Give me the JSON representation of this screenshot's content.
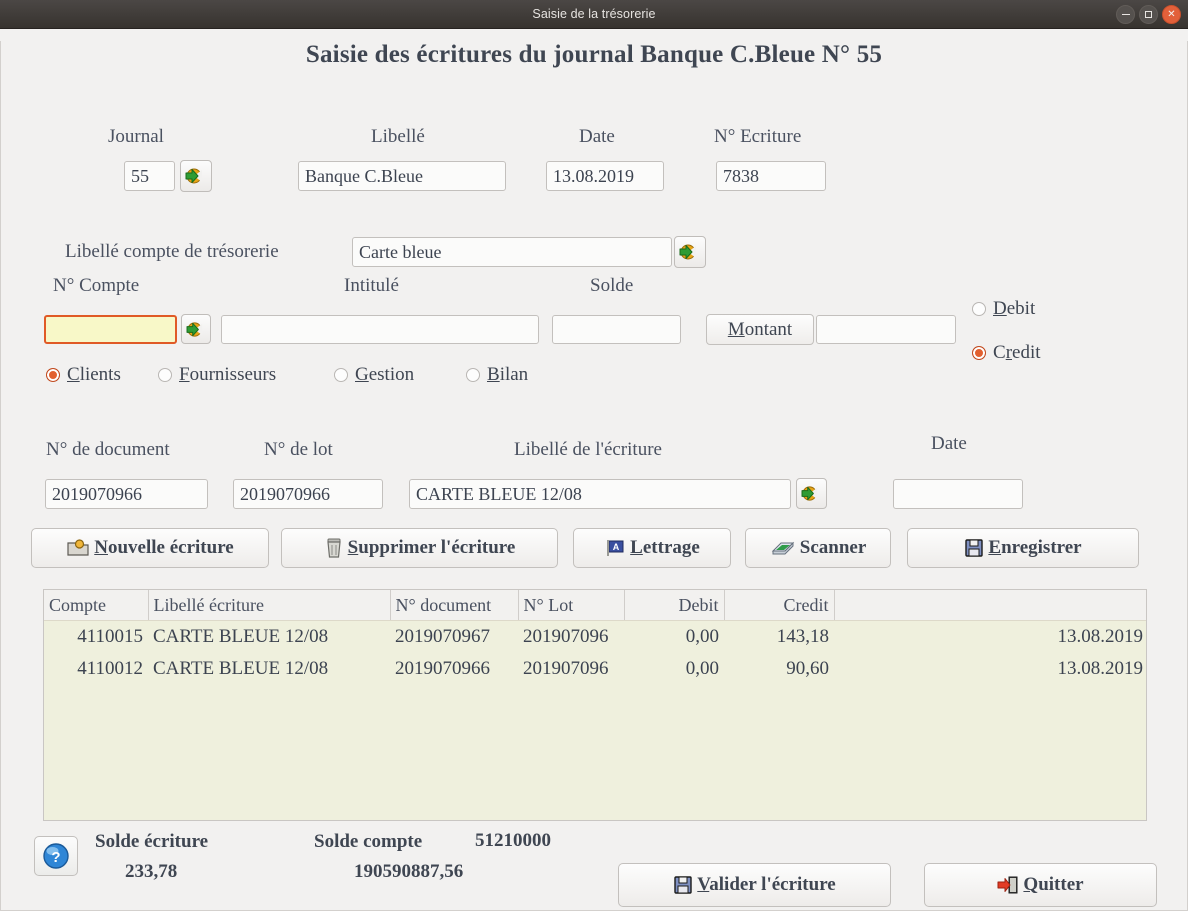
{
  "window": {
    "title": "Saisie de la trésorerie",
    "controls": {
      "minimize": "–",
      "maximize": "□",
      "close": "×"
    }
  },
  "page_title": "Saisie des écritures du journal Banque C.Bleue N° 55",
  "colors": {
    "accent": "#e2602f",
    "grid_background": "#eff0dd",
    "focus_field_background": "#f8f8c8",
    "titlebar": "#3f3b38"
  },
  "header_form": {
    "journal_label": "Journal",
    "journal_value": "55",
    "libelle_label": "Libellé",
    "libelle_value": "Banque C.Bleue",
    "date_label": "Date",
    "date_value": "13.08.2019",
    "ecriture_label": "N° Ecriture",
    "ecriture_value": "7838"
  },
  "treasury": {
    "compte_tresorerie_label": "Libellé compte de trésorerie",
    "compte_tresorerie_value": "Carte bleue",
    "num_compte_label": "N° Compte",
    "num_compte_value": "",
    "intitule_label": "Intitulé",
    "intitule_value": "",
    "solde_label": "Solde",
    "solde_value": "",
    "montant_button": "Montant",
    "montant_value": "",
    "sens": {
      "debit_label": "Debit",
      "credit_label": "Credit",
      "selected": "Credit"
    },
    "categories": {
      "options": [
        "Clients",
        "Fournisseurs",
        "Gestion",
        "Bilan"
      ],
      "selected": "Clients"
    }
  },
  "entry_form": {
    "document_label": "N° de document",
    "document_value": "2019070966",
    "lot_label": "N° de lot",
    "lot_value": "2019070966",
    "libelle_ecriture_label": "Libellé de l'écriture",
    "libelle_ecriture_value": "CARTE BLEUE 12/08",
    "date_label": "Date",
    "date_value": ""
  },
  "toolbar": [
    {
      "label": "Nouvelle écriture",
      "accel": "N",
      "icon": "new-folder-icon"
    },
    {
      "label": "Supprimer l'écriture",
      "accel": "S",
      "icon": "trash-icon"
    },
    {
      "label": "Lettrage",
      "accel": "L",
      "icon": "flag-a-icon"
    },
    {
      "label": "Scanner",
      "accel": "",
      "icon": "scanner-icon"
    },
    {
      "label": "Enregistrer",
      "accel": "E",
      "icon": "floppy-icon"
    }
  ],
  "grid": {
    "columns": [
      "Compte",
      "Libellé écriture",
      "N° document",
      "N° Lot",
      "Debit",
      "Credit",
      ""
    ],
    "rows": [
      {
        "compte": "4110015",
        "libelle": "CARTE BLEUE 12/08",
        "document": "2019070967",
        "lot": "201907096",
        "debit": "0,00",
        "credit": "143,18",
        "date": "13.08.2019"
      },
      {
        "compte": "4110012",
        "libelle": "CARTE BLEUE 12/08",
        "document": "2019070966",
        "lot": "201907096",
        "debit": "0,00",
        "credit": "90,60",
        "date": "13.08.2019"
      }
    ]
  },
  "footer": {
    "help_icon": "help-globe-icon",
    "solde_ecriture_label": "Solde écriture",
    "solde_ecriture_value": "233,78",
    "solde_compte_label": "Solde compte",
    "solde_compte_number": "51210000",
    "solde_compte_value": "190590887,56",
    "valider_label": "Valider l'écriture",
    "valider_accel": "V",
    "quitter_label": "Quitter",
    "quitter_accel": "Q"
  }
}
